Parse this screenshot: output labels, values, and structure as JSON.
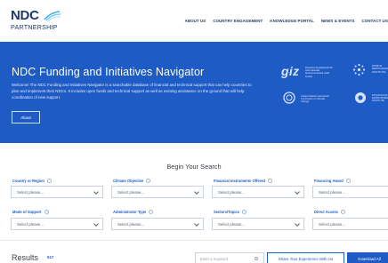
{
  "header": {
    "logo": {
      "main": "NDC",
      "sub": "PARTNERSHIP"
    },
    "nav": [
      {
        "label": "ABOUT US"
      },
      {
        "label": "COUNTRY ENGAGEMENT"
      },
      {
        "label": "KNOWLEDGE PORTAL"
      },
      {
        "label": "NEWS & EVENTS"
      },
      {
        "label": "CONTACT US"
      }
    ]
  },
  "hero": {
    "title": "NDC Funding and Initiatives Navigator",
    "description": "Welcome! The NDC Funding and Initiatives Navigator is a searchable database of financial and technical support that can help countries to plan and implement their NDCs. It includes open funds and technical support as well as existing assistance on the ground that will help coordination of new support.",
    "button": "About",
    "partners": {
      "giz": {
        "logo": "giz",
        "text": "Deutsche Gesellschaft für Internationale Zusammenarbeit (GIZ) GmbH"
      },
      "wri": {
        "icon": "wri-icon",
        "text": "WORLD RESOURCES INSTITUTE"
      },
      "un": {
        "icon": "un-climate-icon",
        "text": "United Nations Framework Convention on Climate Change"
      },
      "x": {
        "icon": "partner-icon",
        "text": "STOCKHOLM ENVIRONMENT INSTITUTE"
      }
    }
  },
  "search": {
    "title": "Begin Your Search",
    "filters": [
      {
        "label": "Country or Region",
        "value": "Select please..."
      },
      {
        "label": "Climate Objective",
        "value": "Select please..."
      },
      {
        "label": "Financial Instruments Offered",
        "value": "Select please..."
      },
      {
        "label": "Financing Award",
        "value": "Select please..."
      },
      {
        "label": "Mode of Support",
        "value": "Select please..."
      },
      {
        "label": "Administrator Type",
        "value": "Select please..."
      },
      {
        "label": "Sectors/Topics",
        "value": "Select please..."
      },
      {
        "label": "Direct Access",
        "value": "Select please..."
      }
    ]
  },
  "results": {
    "title": "Results",
    "count": "517",
    "keyword_placeholder": "Enter a Keyword",
    "share_label": "Share Your Experience With Us",
    "download_label": "Download All"
  },
  "colors": {
    "brand_blue": "#1f5bc4",
    "navy": "#1f3a68"
  }
}
